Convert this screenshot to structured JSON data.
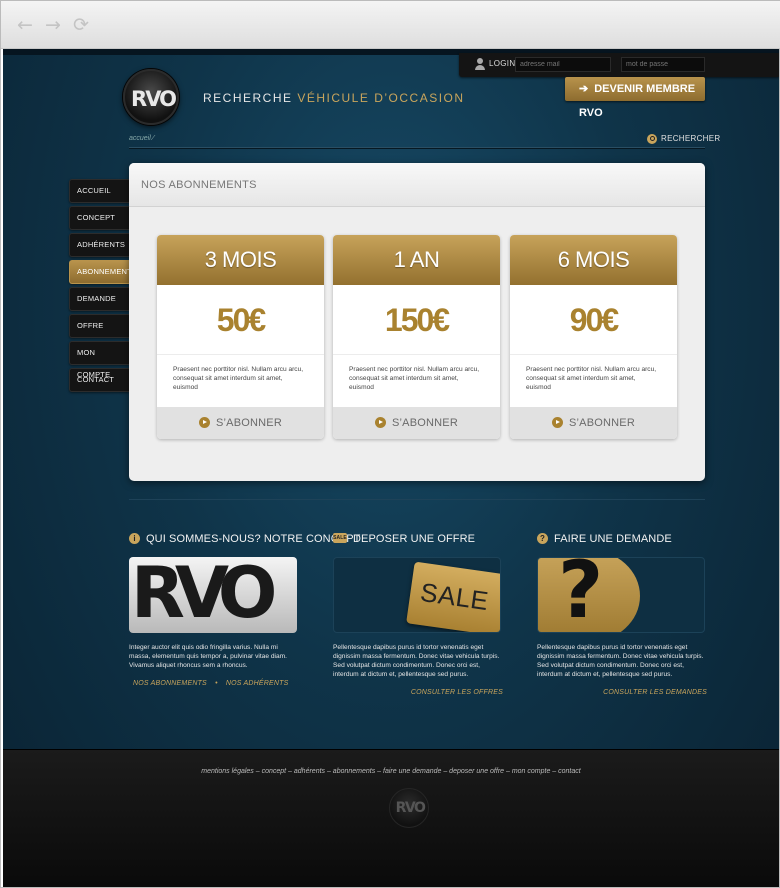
{
  "browser": {
    "back_icon": "←",
    "forward_icon": "→",
    "reload_icon": "⟳"
  },
  "login": {
    "label": "LOGIN",
    "email_placeholder": "adresse mail",
    "password_placeholder": "mot de passe"
  },
  "header": {
    "logo": "RVO",
    "tagline_plain": "RECHERCHE ",
    "tagline_gold": "VÉHICULE D’OCCASION",
    "cta": "DEVENIR MEMBRE RVO",
    "cta_icon": "➔"
  },
  "breadcrumb": "accueil ⁄",
  "search_label": "RECHERCHER",
  "sidebar": {
    "items": [
      {
        "label": "ACCUEIL"
      },
      {
        "label": "CONCEPT"
      },
      {
        "label": "ADHÉRENTS"
      },
      {
        "label": "ABONNEMENTS"
      },
      {
        "label": "DEMANDE"
      },
      {
        "label": "OFFRE"
      },
      {
        "label": "MON COMPTE"
      },
      {
        "label": "CONTACT"
      }
    ],
    "active": "ABONNEMENTS"
  },
  "panel": {
    "title": "NOS ABONNEMENTS",
    "plans": [
      {
        "duration": "3 MOIS",
        "price": "50€",
        "description": "Praesent nec porttitor nisl. Nullam arcu arcu, consequat sit amet interdum sit amet, euismod",
        "button": "S’ABONNER"
      },
      {
        "duration": "1 AN",
        "price": "150€",
        "description": "Praesent nec porttitor nisl. Nullam arcu arcu, consequat sit amet interdum sit amet, euismod",
        "button": "S’ABONNER"
      },
      {
        "duration": "6 MOIS",
        "price": "90€",
        "description": "Praesent nec porttitor nisl. Nullam arcu arcu, consequat sit amet interdum sit amet, euismod",
        "button": "S’ABONNER"
      }
    ]
  },
  "sections": [
    {
      "icon": "i",
      "title": "QUI SOMMES-NOUS? NOTRE CONCEPT",
      "image_text": "RVO",
      "text": "Integer auctor elit quis odio fringilla varius. Nulla mi massa, elementum quis tempor a, pulvinar vitae diam. Vivamus aliquet rhoncus sem a rhoncus.",
      "link1": "NOS ABONNEMENTS",
      "link_sep": "•",
      "link2": "NOS ADHÉRENTS"
    },
    {
      "icon": "SALE",
      "title": "DEPOSER UNE OFFRE",
      "image_text": "SALE",
      "text": "Pellentesque dapibus purus id tortor venenatis eget dignissim massa fermentum. Donec vitae vehicula turpis. Sed volutpat dictum condimentum. Donec orci est, interdum at dictum et, pellentesque sed purus.",
      "link1": "CONSULTER LES OFFRES"
    },
    {
      "icon": "?",
      "title": "FAIRE UNE DEMANDE",
      "image_text": "?",
      "text": "Pellentesque dapibus purus id tortor venenatis eget dignissim massa fermentum. Donec vitae vehicula turpis. Sed volutpat dictum condimentum. Donec orci est, interdum at dictum et, pellentesque sed purus.",
      "link1": "CONSULTER LES DEMANDES"
    }
  ],
  "footer": {
    "links": "mentions légales – concept – adhérents – abonnements – faire une demande – deposer une offre – mon compte – contact",
    "logo": "RVO"
  }
}
